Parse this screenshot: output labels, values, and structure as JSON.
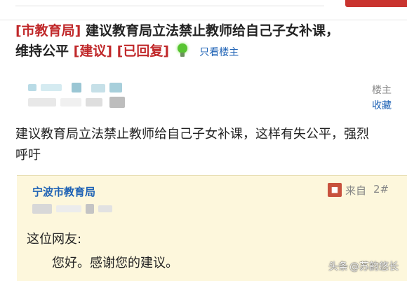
{
  "colors": {
    "accent_red": "#c0282a",
    "link_blue": "#1e62b5",
    "reply_bg": "#fdf7dc",
    "bulb_green": "#57c431"
  },
  "thread": {
    "dept_tag": "[市教育局]",
    "title_text": "建议教育局立法禁止教师给自己子女补课，维持公平",
    "type_tag": "[建议]",
    "status_tag": "[已回复]",
    "status_icon": "lightbulb-icon",
    "only_op_label": "只看楼主"
  },
  "post": {
    "floor_label": "楼主",
    "favorite_label": "收藏",
    "body": "建议教育局立法禁止教师给自己子女补课，这样有失公平，强烈呼吁"
  },
  "reply": {
    "author": "宁波市教育局",
    "from_icon": "reply-source-icon",
    "from_label": "来自",
    "floor": "2#",
    "greeting": "这位网友:",
    "text": "您好。感谢您的建议。"
  },
  "watermark": {
    "prefix": "头条",
    "handle": "@苏韵悠长"
  }
}
